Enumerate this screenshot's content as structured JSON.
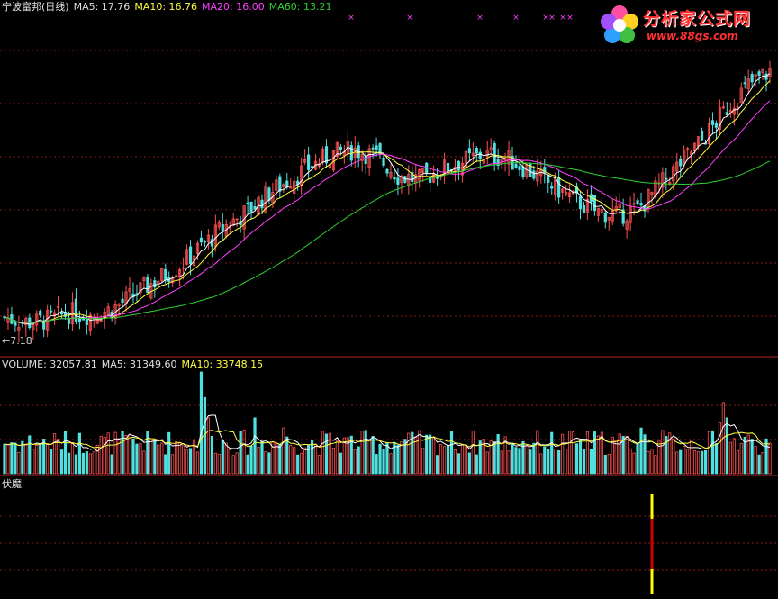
{
  "header": {
    "stock_name": "宁波富邦(日线)",
    "ma5_label": "MA5: 17.76",
    "ma10_label": "MA10: 16.76",
    "ma20_label": "MA20: 16.00",
    "ma60_label": "MA60: 13.21"
  },
  "volume_header": {
    "volume_label": "VOLUME: 32057.81",
    "ma5_label": "MA5: 31349.60",
    "ma10_label": "MA10: 33748.15"
  },
  "indicator_header": {
    "name": "伏魔"
  },
  "low_marker": "←7.18",
  "logo": {
    "title": "分析家公式网",
    "url": "www.88gs.com"
  },
  "colors": {
    "background": "#000000",
    "grid": "#8b1a1a",
    "panel_border": "#b22222",
    "up_candle": "#ff5050",
    "down_candle": "#50e0e0",
    "ma5": "#ffffff",
    "ma10": "#ffff40",
    "ma20": "#ff40ff",
    "ma60": "#30d030",
    "signal_yellow": "#ffff00",
    "signal_red": "#cc0000",
    "cross_marker": "#ff40ff"
  },
  "chart_data": {
    "type": "candlestick",
    "title": "宁波富邦(日线)",
    "price_low": 7.18,
    "price_last_ma": {
      "MA5": 17.76,
      "MA10": 16.76,
      "MA20": 16.0,
      "MA60": 13.21
    },
    "volume_last": {
      "VOLUME": 32057.81,
      "MA5": 31349.6,
      "MA10": 33748.15
    },
    "indicator": "伏魔",
    "series_shape": [
      {
        "name": "price_path",
        "values": [
          8.0,
          7.8,
          7.9,
          8.2,
          8.1,
          8.4,
          9.0,
          9.6,
          10.2,
          11.0,
          11.8,
          12.4,
          13.2,
          13.8,
          14.4,
          14.9,
          15.1,
          14.8,
          14.0,
          13.8,
          14.3,
          14.6,
          14.9,
          14.7,
          14.2,
          13.6,
          13.0,
          12.5,
          12.3,
          12.6,
          13.6,
          14.6,
          15.6,
          16.8,
          17.8,
          18.4
        ]
      }
    ]
  }
}
